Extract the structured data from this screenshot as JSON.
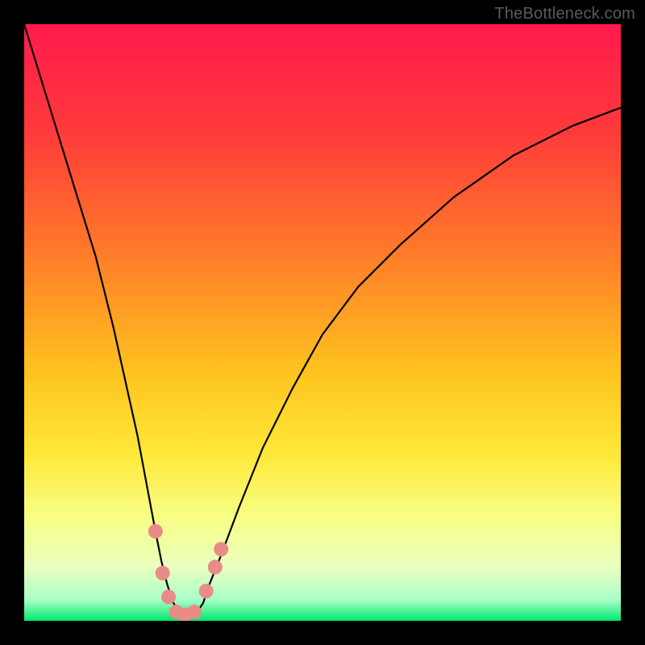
{
  "watermark": "TheBottleneck.com",
  "colors": {
    "frame_bg": "#000000",
    "gradient_top": "#ff1a4d",
    "gradient_upper_mid": "#ff7a2a",
    "gradient_mid": "#ffd21f",
    "gradient_lower_mid": "#f7ff55",
    "gradient_low": "#e9ffbf",
    "gradient_bottom": "#00e86b",
    "curve_stroke": "#000000",
    "marker_fill": "#e98b86",
    "marker_stroke": "#c96a63"
  },
  "chart_data": {
    "type": "line",
    "title": "",
    "xlabel": "",
    "ylabel": "",
    "xlim": [
      0,
      100
    ],
    "ylim": [
      0,
      100
    ],
    "series": [
      {
        "name": "bottleneck-curve",
        "x": [
          0,
          4,
          8,
          12,
          15,
          17,
          19,
          20.5,
          22,
          23,
          24,
          25,
          26,
          27,
          28,
          29,
          30,
          31,
          33,
          36,
          40,
          45,
          50,
          56,
          63,
          72,
          82,
          92,
          100
        ],
        "y": [
          100,
          87,
          74,
          61,
          49,
          40,
          31,
          23,
          15,
          10,
          6,
          3,
          1.5,
          1,
          1,
          1.5,
          3,
          6,
          11,
          19,
          29,
          39,
          48,
          56,
          63,
          71,
          78,
          83,
          86
        ]
      }
    ],
    "markers": [
      {
        "x": 22.0,
        "y": 15.0
      },
      {
        "x": 23.2,
        "y": 8.0
      },
      {
        "x": 24.2,
        "y": 4.0
      },
      {
        "x": 25.5,
        "y": 1.5
      },
      {
        "x": 27.0,
        "y": 1.0
      },
      {
        "x": 28.5,
        "y": 1.5
      },
      {
        "x": 30.5,
        "y": 5.0
      },
      {
        "x": 32.0,
        "y": 9.0
      },
      {
        "x": 33.0,
        "y": 12.0
      }
    ],
    "gradient_stops": [
      {
        "offset": 0.0,
        "color": "#ff1a4d"
      },
      {
        "offset": 0.18,
        "color": "#ff3a3a"
      },
      {
        "offset": 0.38,
        "color": "#ff7a2a"
      },
      {
        "offset": 0.58,
        "color": "#ffc21f"
      },
      {
        "offset": 0.72,
        "color": "#ffe838"
      },
      {
        "offset": 0.83,
        "color": "#f7ff88"
      },
      {
        "offset": 0.91,
        "color": "#e9ffbf"
      },
      {
        "offset": 0.965,
        "color": "#a8ffc8"
      },
      {
        "offset": 1.0,
        "color": "#00e86b"
      }
    ]
  }
}
